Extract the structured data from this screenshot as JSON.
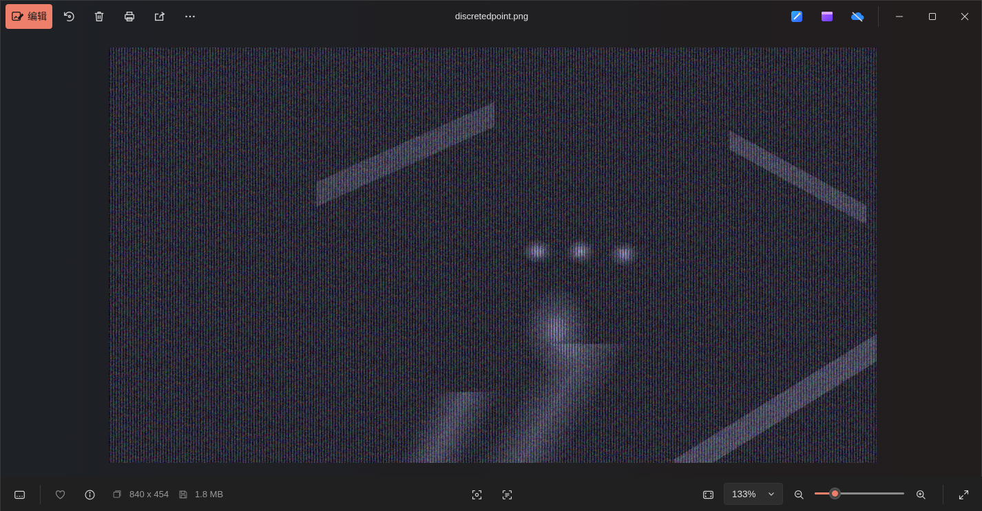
{
  "toolbar": {
    "edit_label": "编辑",
    "edit_icon": "edit-image-icon",
    "tools": [
      "rotate-icon",
      "delete-icon",
      "print-icon",
      "share-icon",
      "more-icon"
    ]
  },
  "title": "discretedpoint.png",
  "app_icons": [
    "designer-icon",
    "clipchamp-icon",
    "onedrive-icon"
  ],
  "window_controls": [
    "minimize-icon",
    "maximize-icon",
    "close-icon"
  ],
  "bottom": {
    "dimensions": "840 x 454",
    "file_size": "1.8 MB",
    "zoom": "133%",
    "zoom_level": 0.22
  },
  "colors": {
    "accent": "#ee7f6a"
  }
}
